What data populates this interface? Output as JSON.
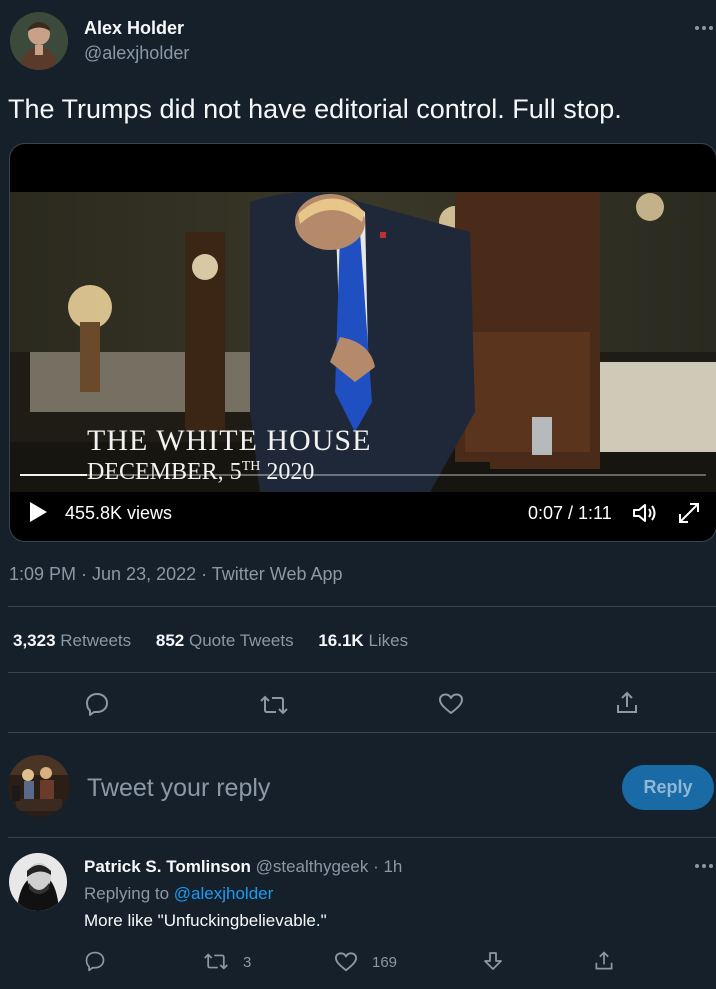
{
  "tweet": {
    "author_name": "Alex Holder",
    "author_handle": "@alexjholder",
    "text": "The Trumps did not have editorial control. Full stop.",
    "timestamp": "1:09 PM · Jun 23, 2022 · Twitter Web App",
    "more_icon": "more-horizontal-icon"
  },
  "video": {
    "overlay_line1": "THE WHITE HOUSE",
    "overlay_line2_prefix": "DECEMBER, 5",
    "overlay_line2_sup": "TH",
    "overlay_line2_year": "2020",
    "views": "455.8K views",
    "time": "0:07 / 1:11",
    "progress": 0.098
  },
  "stats": {
    "retweets_count": "3,323",
    "retweets_label": "Retweets",
    "quotes_count": "852",
    "quotes_label": "Quote Tweets",
    "likes_count": "16.1K",
    "likes_label": "Likes"
  },
  "composer": {
    "placeholder": "Tweet your reply",
    "button_label": "Reply"
  },
  "reply": {
    "author_name": "Patrick S. Tomlinson",
    "author_handle": "@stealthygeek",
    "time": "· 1h",
    "replying_prefix": "Replying to",
    "replying_handle": "@alexjholder",
    "text": "More like \"Unfuckingbelievable.\"",
    "retweet_count": "3",
    "like_count": "169"
  },
  "colors": {
    "background": "#15202b",
    "accent": "#1d9bf0",
    "muted": "#8b98a5",
    "divider": "#38444d"
  }
}
